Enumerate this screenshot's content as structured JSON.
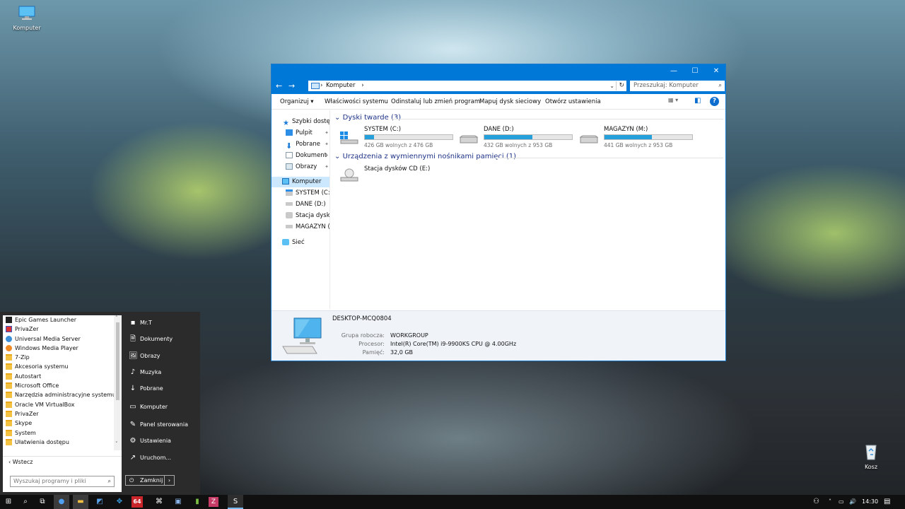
{
  "desktop": {
    "icons": [
      {
        "label": "Komputer",
        "icon": "computer-icon"
      },
      {
        "label": "Kosz",
        "icon": "recycle-bin-icon"
      }
    ]
  },
  "explorer": {
    "title": "",
    "window_controls": {
      "minimize": "—",
      "maximize": "☐",
      "close": "✕"
    },
    "nav": {
      "back": "←",
      "forward": "→",
      "up": "↑"
    },
    "address": {
      "separator": "›",
      "path": "Komputer",
      "trailing": "›",
      "dropdown": "⌄",
      "refresh": "↻"
    },
    "search": {
      "placeholder": "Przeszukaj: Komputer",
      "icon": "⌕"
    },
    "toolbar": {
      "items": [
        "Organizuj ▾",
        "Właściwości systemu",
        "Odinstaluj lub zmień program",
        "Mapuj dysk sieciowy",
        "Otwórz ustawienia"
      ],
      "view_icon": "▦ ▾",
      "pane_icon": "◧",
      "help": "?"
    },
    "navpane": [
      {
        "label": "Szybki dostęp",
        "icon": "star-icon",
        "pinned": false,
        "selected": false
      },
      {
        "label": "Pulpit",
        "icon": "desktop-icon",
        "pinned": true,
        "selected": false
      },
      {
        "label": "Pobrane",
        "icon": "download-icon",
        "pinned": true,
        "selected": false
      },
      {
        "label": "Dokument",
        "icon": "document-icon",
        "pinned": true,
        "selected": false
      },
      {
        "label": "Obrazy",
        "icon": "pictures-icon",
        "pinned": true,
        "selected": false
      },
      {
        "label": "Komputer",
        "icon": "computer-icon",
        "pinned": false,
        "selected": true
      },
      {
        "label": "SYSTEM (C:)",
        "icon": "drive-icon",
        "pinned": false,
        "selected": false
      },
      {
        "label": "DANE (D:)",
        "icon": "drive-icon",
        "pinned": false,
        "selected": false
      },
      {
        "label": "Stacja dysków",
        "icon": "cd-drive-icon",
        "pinned": false,
        "selected": false
      },
      {
        "label": "MAGAZYN (M:",
        "icon": "drive-icon",
        "pinned": false,
        "selected": false
      },
      {
        "label": "Sieć",
        "icon": "network-icon",
        "pinned": false,
        "selected": false
      }
    ],
    "pin_glyph": "📌",
    "groups": {
      "hard_drives": {
        "header": "Dyski twarde (3)",
        "drives": [
          {
            "name": "SYSTEM (C:)",
            "free_text": "426 GB wolnych z 476 GB",
            "used_fraction": 0.105,
            "icon": "windows-drive-icon"
          },
          {
            "name": "DANE (D:)",
            "free_text": "432 GB wolnych z 953 GB",
            "used_fraction": 0.547,
            "icon": "drive-icon"
          },
          {
            "name": "MAGAZYN (M:)",
            "free_text": "441 GB wolnych z 953 GB",
            "used_fraction": 0.537,
            "icon": "drive-icon"
          }
        ]
      },
      "removable": {
        "header": "Urządzenia z wymiennymi nośnikami pamięci (1)",
        "devices": [
          {
            "name": "Stacja dysków CD (E:)",
            "icon": "cd-drive-icon"
          }
        ]
      }
    },
    "details": {
      "pc_name": "DESKTOP-MCQ0804",
      "rows": [
        {
          "label": "Grupa robocza:",
          "value": "WORKGROUP"
        },
        {
          "label": "Procesor:",
          "value": "Intel(R) Core(TM) i9-9900KS CPU @ 4.00GHz"
        },
        {
          "label": "Pamięć:",
          "value": "32,0 GB"
        }
      ]
    }
  },
  "startmenu": {
    "programs": [
      {
        "label": "Epic Games Launcher",
        "icon": "epic-icon"
      },
      {
        "label": "PrivaZer",
        "icon": "privazer-icon"
      },
      {
        "label": "Universal Media Server",
        "icon": "ums-icon"
      },
      {
        "label": "Windows Media Player",
        "icon": "wmp-icon"
      },
      {
        "label": "7-Zip",
        "icon": "folder-icon"
      },
      {
        "label": "Akcesoria systemu",
        "icon": "folder-icon"
      },
      {
        "label": "Autostart",
        "icon": "folder-icon"
      },
      {
        "label": "Microsoft Office",
        "icon": "folder-icon"
      },
      {
        "label": "Narzędzia administracyjne systemu W...",
        "icon": "folder-icon"
      },
      {
        "label": "Oracle VM VirtualBox",
        "icon": "folder-icon"
      },
      {
        "label": "PrivaZer",
        "icon": "folder-icon"
      },
      {
        "label": "Skype",
        "icon": "folder-icon"
      },
      {
        "label": "System",
        "icon": "folder-icon"
      },
      {
        "label": "Ułatwienia dostępu",
        "icon": "folder-icon"
      }
    ],
    "scroll_up": "˄",
    "scroll_down": "˅",
    "back": "‹   Wstecz",
    "search_placeholder": "Wyszukaj programy i pliki",
    "search_icon": "⌕",
    "places": [
      {
        "label": "Mr.T",
        "icon": "user-icon",
        "glyph": "▪"
      },
      {
        "label": "Dokumenty",
        "icon": "document-icon",
        "glyph": "🗎"
      },
      {
        "label": "Obrazy",
        "icon": "pictures-icon",
        "glyph": "🖼"
      },
      {
        "label": "Muzyka",
        "icon": "music-icon",
        "glyph": "♪"
      },
      {
        "label": "Pobrane",
        "icon": "download-icon",
        "glyph": "↓"
      },
      {
        "label": "Komputer",
        "icon": "computer-icon",
        "glyph": "▭"
      },
      {
        "label": "Panel sterowania",
        "icon": "control-panel-icon",
        "glyph": "✎"
      },
      {
        "label": "Ustawienia",
        "icon": "gear-icon",
        "glyph": "⚙"
      },
      {
        "label": "Uruchom...",
        "icon": "run-icon",
        "glyph": "↗"
      }
    ],
    "shutdown": {
      "label": "Zamknij",
      "icon": "⏻",
      "arrow": "›"
    }
  },
  "taskbar": {
    "buttons": [
      {
        "name": "start-button",
        "glyph": "⊞",
        "state": "normal"
      },
      {
        "name": "search-button",
        "glyph": "⌕",
        "state": "normal"
      },
      {
        "name": "task-view-button",
        "glyph": "⧉",
        "state": "normal"
      },
      {
        "name": "chrome-button",
        "glyph": "●",
        "state": "active"
      },
      {
        "name": "explorer-button",
        "glyph": "▬",
        "state": "active"
      },
      {
        "name": "app-button-1",
        "glyph": "◩",
        "state": "normal"
      },
      {
        "name": "app-button-2",
        "glyph": "✥",
        "state": "normal"
      },
      {
        "name": "app-button-3",
        "glyph": "64",
        "state": "normal"
      },
      {
        "name": "app-button-4",
        "glyph": "⌘",
        "state": "normal"
      },
      {
        "name": "app-button-5",
        "glyph": "▣",
        "state": "normal"
      },
      {
        "name": "app-button-6",
        "glyph": "▮",
        "state": "normal"
      },
      {
        "name": "app-button-7",
        "glyph": "Z",
        "state": "normal"
      },
      {
        "name": "skype-button",
        "glyph": "S",
        "state": "running"
      }
    ],
    "tray": {
      "people": "⚇",
      "chevron": "˄",
      "network": "▭",
      "volume": "🔊",
      "time": "14:30",
      "notifications": "▤"
    }
  },
  "colors": {
    "accent": "#0078d7",
    "drive_fill": "#26a0da",
    "group_header": "#1e3287"
  }
}
